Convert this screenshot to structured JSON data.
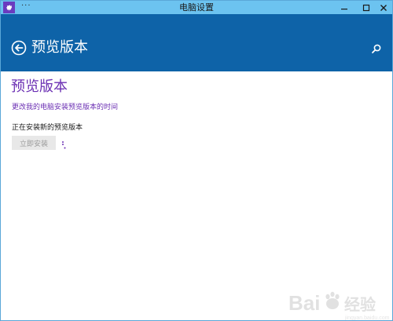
{
  "window": {
    "title": "电脑设置",
    "menu_glyph": "···"
  },
  "header": {
    "title": "预览版本"
  },
  "page": {
    "heading": "预览版本",
    "schedule_link": "更改我的电脑安装预览版本的时间",
    "status_text": "正在安装新的预览版本",
    "install_button_label": "立即安装"
  },
  "colors": {
    "titlebar": "#6cc3f0",
    "header": "#0e63a8",
    "accent": "#6b2fb3",
    "app_icon": "#6a3cbf"
  },
  "icons": [
    "settings-gear-icon",
    "minimize-icon",
    "maximize-icon",
    "close-icon",
    "back-arrow-icon",
    "search-icon",
    "loading-spinner-icon"
  ],
  "watermark": {
    "label": "Baidu经验"
  }
}
